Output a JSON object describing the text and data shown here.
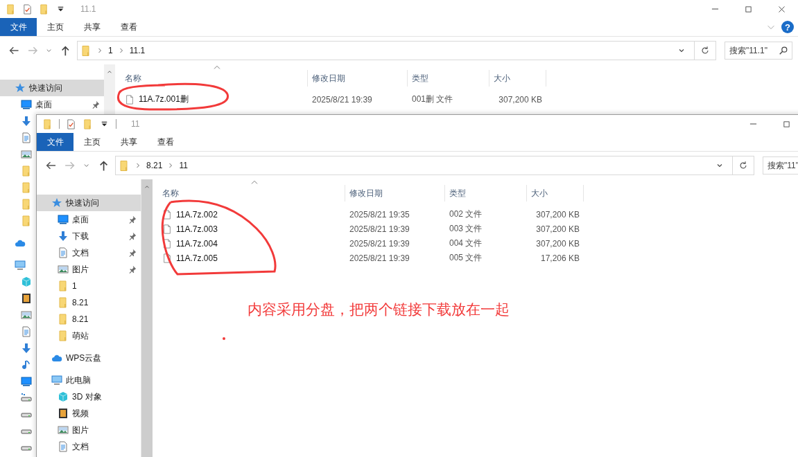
{
  "back_window": {
    "title": "11.1",
    "quick_access": [
      {
        "kind": "folder"
      },
      {
        "kind": "checkdoc"
      },
      {
        "kind": "folder"
      },
      {
        "kind": "caret"
      }
    ],
    "window_buttons": [
      {
        "kind": "minimize"
      },
      {
        "kind": "maximize"
      },
      {
        "kind": "close"
      }
    ],
    "ribbon_tabs": [
      {
        "label": "文件",
        "kind": "file"
      },
      {
        "label": "主页",
        "kind": "tab"
      },
      {
        "label": "共享",
        "kind": "tab"
      },
      {
        "label": "查看",
        "kind": "tab"
      }
    ],
    "help": "?",
    "breadcrumb": [
      "1",
      "11.1"
    ],
    "search": {
      "placeholder": "搜索\"11.1\""
    },
    "sidebar": [
      {
        "label": "快速访问",
        "kind": "star",
        "selected": true,
        "children": [
          {
            "label": "桌面",
            "kind": "desktop",
            "pinned": true,
            "selected": false
          },
          {
            "kind": "download"
          },
          {
            "kind": "document"
          },
          {
            "kind": "picture"
          },
          {
            "kind": "folder"
          },
          {
            "kind": "folder"
          },
          {
            "kind": "folder"
          },
          {
            "kind": "folder"
          }
        ]
      },
      {
        "kind": "cloud"
      },
      {
        "kind": "pc",
        "children": [
          {
            "kind": "cube"
          },
          {
            "kind": "video"
          },
          {
            "kind": "picture"
          },
          {
            "kind": "document"
          },
          {
            "kind": "download"
          },
          {
            "kind": "music"
          },
          {
            "kind": "desktop"
          },
          {
            "kind": "usb"
          },
          {
            "kind": "drive"
          },
          {
            "kind": "drive"
          },
          {
            "kind": "drive"
          }
        ]
      }
    ],
    "columns": [
      "名称",
      "修改日期",
      "类型",
      "大小"
    ],
    "files": [
      {
        "name": "11A.7z.001删",
        "date": "2025/8/21 19:39",
        "type": "001删 文件",
        "size": "307,200 KB"
      }
    ]
  },
  "front_window": {
    "title": "11",
    "quick_access": [
      {
        "kind": "folder"
      },
      {
        "kind": "separator"
      },
      {
        "kind": "checkdoc"
      },
      {
        "kind": "folder"
      },
      {
        "kind": "caret"
      },
      {
        "kind": "separator"
      }
    ],
    "window_buttons": [
      {
        "kind": "minimize"
      },
      {
        "kind": "maximize"
      }
    ],
    "ribbon_tabs": [
      {
        "label": "文件",
        "kind": "file"
      },
      {
        "label": "主页",
        "kind": "tab"
      },
      {
        "label": "共享",
        "kind": "tab"
      },
      {
        "label": "查看",
        "kind": "tab"
      }
    ],
    "breadcrumb": [
      "8.21",
      "11"
    ],
    "search": {
      "placeholder": "搜索\"11\""
    },
    "sidebar": [
      {
        "label": "快速访问",
        "kind": "star",
        "selected": true,
        "children": [
          {
            "label": "桌面",
            "kind": "desktop",
            "pinned": true,
            "selected": false
          },
          {
            "label": "下载",
            "kind": "download",
            "pinned": true,
            "selected": false
          },
          {
            "label": "文档",
            "kind": "document",
            "pinned": true,
            "selected": false
          },
          {
            "label": "图片",
            "kind": "picture",
            "pinned": true,
            "selected": false
          },
          {
            "label": "1",
            "kind": "folder",
            "pinned": false,
            "selected": false
          },
          {
            "label": "8.21",
            "kind": "folder",
            "pinned": false,
            "selected": false
          },
          {
            "label": "8.21",
            "kind": "folder",
            "pinned": false,
            "selected": false
          },
          {
            "label": "萌站",
            "kind": "folder",
            "pinned": false,
            "selected": false
          }
        ]
      },
      {
        "label": "WPS云盘",
        "kind": "cloud",
        "selected": false
      },
      {
        "label": "此电脑",
        "kind": "pc",
        "selected": false,
        "children": [
          {
            "label": "3D 对象",
            "kind": "cube",
            "pinned": false,
            "selected": false
          },
          {
            "label": "视频",
            "kind": "video",
            "pinned": false,
            "selected": false
          },
          {
            "label": "图片",
            "kind": "picture",
            "pinned": false,
            "selected": false
          },
          {
            "label": "文档",
            "kind": "document",
            "pinned": false,
            "selected": false
          }
        ]
      }
    ],
    "columns": [
      "名称",
      "修改日期",
      "类型",
      "大小"
    ],
    "files": [
      {
        "name": "11A.7z.002",
        "date": "2025/8/21 19:35",
        "type": "002 文件",
        "size": "307,200 KB"
      },
      {
        "name": "11A.7z.003",
        "date": "2025/8/21 19:39",
        "type": "003 文件",
        "size": "307,200 KB"
      },
      {
        "name": "11A.7z.004",
        "date": "2025/8/21 19:39",
        "type": "004 文件",
        "size": "307,200 KB"
      },
      {
        "name": "11A.7z.005",
        "date": "2025/8/21 19:39",
        "type": "005 文件",
        "size": "17,206 KB"
      }
    ]
  },
  "annotation": {
    "text": "内容采用分盘，把两个链接下载放在一起"
  }
}
